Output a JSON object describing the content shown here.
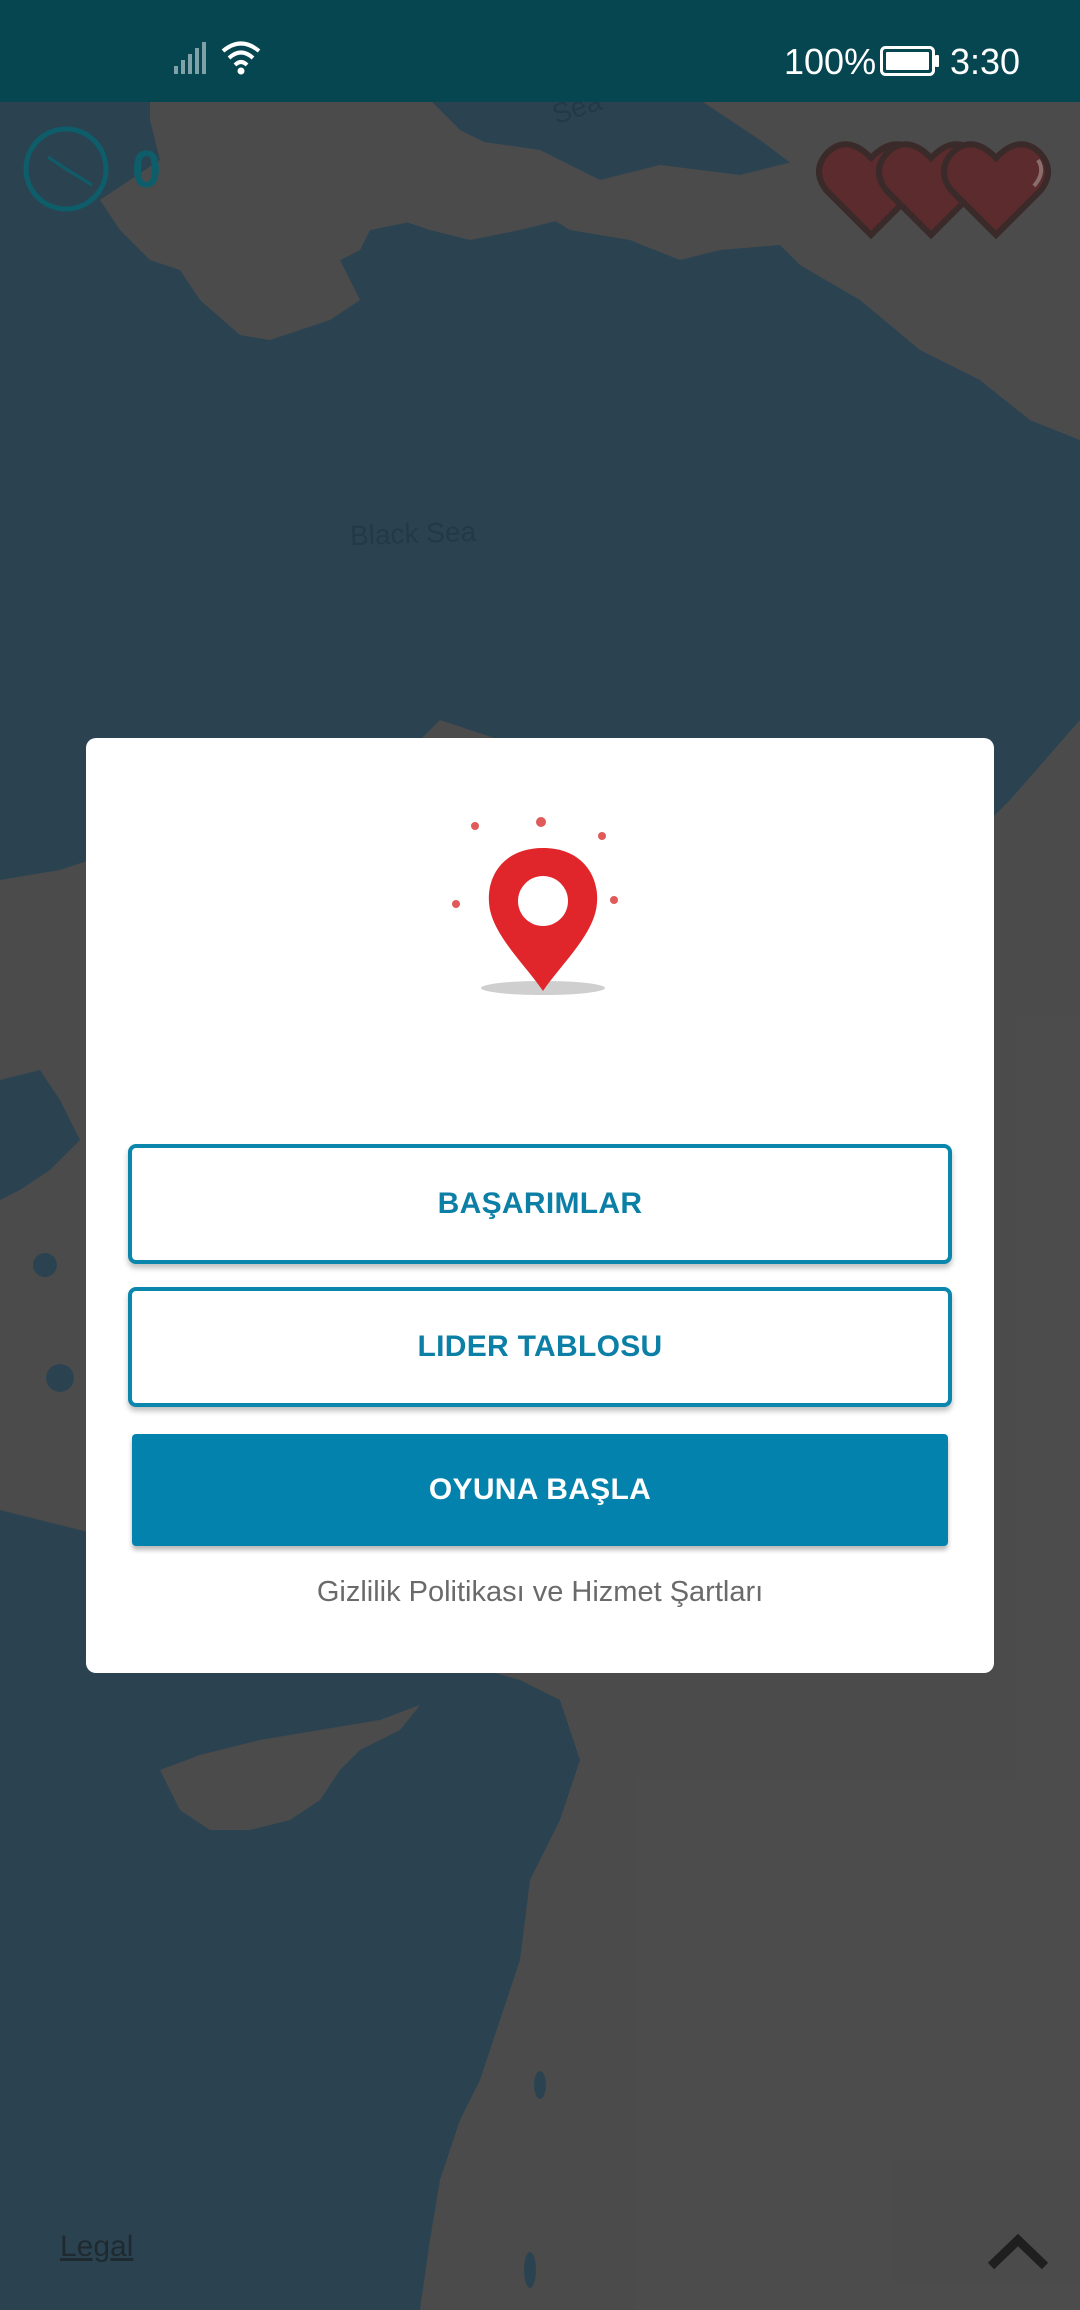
{
  "status_bar": {
    "battery_percent": "100%",
    "time": "3:30",
    "icons": [
      "signal-icon",
      "wifi-icon",
      "battery-icon"
    ]
  },
  "map": {
    "labels": {
      "black_sea": "Black Sea",
      "top_sea": "Sea"
    }
  },
  "hud": {
    "score": "0",
    "lives": 3,
    "icons": [
      "timer-icon",
      "heart-icon"
    ]
  },
  "dialog": {
    "icon": "location-pin-icon",
    "achievements_label": "BAŞARIMLAR",
    "leaderboard_label": "LIDER TABLOSU",
    "start_label": "OYUNA BAŞLA",
    "privacy_link": "Gizlilik Politikası ve Hizmet Şartları"
  },
  "footer": {
    "legal_link": "Legal",
    "scroll_icon": "chevron-up-icon"
  },
  "colors": {
    "status_bar": "#064651",
    "sea": "#3a5a6c",
    "land": "#656565",
    "accent": "#0382ad",
    "pin": "#e0262a"
  }
}
